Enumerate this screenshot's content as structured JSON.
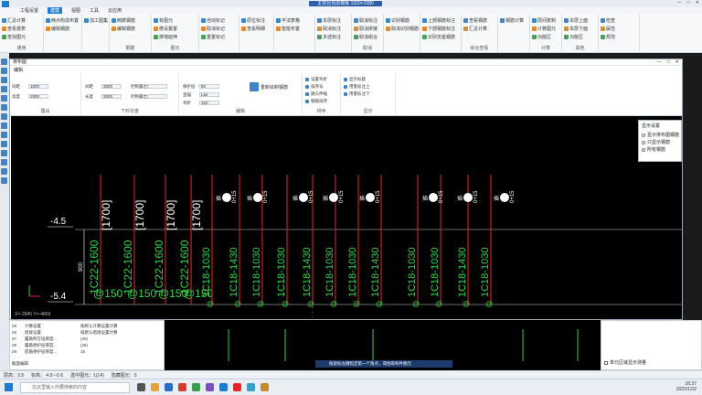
{
  "titlebar": {
    "center_title": "主控台顶层模板   1920×1080",
    "window_controls": [
      "—",
      "□",
      "✕"
    ]
  },
  "menu": {
    "items": [
      "工程设置",
      "建模",
      "视图",
      "工具",
      "云应用"
    ],
    "active": "建模"
  },
  "ribbon": {
    "groups": [
      {
        "label": "通用",
        "buttons": [
          "汇总计算",
          "查看报表",
          "查找图元"
        ]
      },
      {
        "label": "",
        "buttons": [
          "两点构造布置",
          "编辑钢筋"
        ]
      },
      {
        "label": "",
        "buttons": [
          "加工图集"
        ]
      },
      {
        "label": "钢筋",
        "buttons": [
          "两数钢筋",
          "编辑钢筋"
        ]
      },
      {
        "label": "图元",
        "buttons": [
          "有图元",
          "按设置置",
          "按墙延伸"
        ]
      },
      {
        "label": "",
        "buttons": [
          "自动标记",
          "取消标记",
          "重置标记"
        ]
      },
      {
        "label": "",
        "buttons": [
          "原位标注",
          "查看明细"
        ]
      },
      {
        "label": "",
        "buttons": [
          "平法表格",
          "智能布置"
        ]
      },
      {
        "label": "",
        "buttons": [
          "本层标注",
          "取消标注",
          "多选标注"
        ]
      },
      {
        "label": "取消",
        "buttons": [
          "取消标注",
          "取消拼接",
          "取消组合"
        ]
      },
      {
        "label": "",
        "buttons": [
          "识别钢筋",
          "取消识别钢筋"
        ]
      },
      {
        "label": "",
        "buttons": [
          "上部钢筋标注",
          "下部钢筋标注",
          "识别支座钢筋"
        ]
      },
      {
        "label": "综合查看",
        "buttons": [
          "查看钢筋",
          "汇总计算"
        ]
      },
      {
        "label": "",
        "buttons": [
          "钢筋计算"
        ]
      },
      {
        "label": "计算",
        "buttons": [
          "层间复制",
          "计算图元",
          "功能区"
        ]
      },
      {
        "label": "其他",
        "buttons": [
          "本层上面",
          "本层下面",
          "功能区"
        ]
      },
      {
        "label": "",
        "buttons": [
          "检查",
          "属性",
          "规范"
        ]
      }
    ]
  },
  "dialog": {
    "title": "排布图",
    "tab": "编辑",
    "toolbar": {
      "groups": [
        {
          "label": "露出",
          "fields": [
            {
              "name": "间距",
              "value": "1000"
            },
            {
              "name": "高度",
              "value": "2000"
            }
          ]
        },
        {
          "label": "下料长度",
          "fields": [
            {
              "name": "间距",
              "value": "3000"
            },
            {
              "name": "长度",
              "value": "3000"
            },
            {
              "name": "控制露出",
              "value": ""
            },
            {
              "name": "控制露出",
              "value": ""
            }
          ]
        },
        {
          "label": "编辑",
          "fields": [
            {
              "name": "保护层",
              "value": "50"
            },
            {
              "name": "直锚",
              "value": "Lae"
            },
            {
              "name": "弯折",
              "value": "150"
            }
          ]
        },
        {
          "label": "排序",
          "items": [
            "设置弯折",
            "排序号",
            "跳头伸缩",
            "钢筋排序"
          ]
        },
        {
          "label": "显示",
          "items": [
            "显示标题",
            "用量标注上",
            "用量标注下"
          ]
        }
      ],
      "redraw_button": "重新绘制钢筋",
      "scale_label": "1:1"
    },
    "canvas": {
      "elev_top": "-4.5",
      "elev_bottom": "-5.4",
      "dim_vertical": "900",
      "coord_readout": "X=-2845 Y=-4869",
      "left_labels": [
        {
          "text": "1C22-1600",
          "bracket": "[1700]",
          "spacing": "@150"
        },
        {
          "text": "1C22-1600",
          "bracket": "[1700]",
          "spacing": "@150"
        },
        {
          "text": "1C22-1600",
          "bracket": "[1700]",
          "spacing": "@150"
        },
        {
          "text": "1C22-1600",
          "bracket": "[1700]",
          "spacing": "@150"
        }
      ],
      "right_labels": [
        {
          "text": "1C18-1030",
          "spacing": "@"
        },
        {
          "text": "1C18-1430",
          "spacing": "@"
        },
        {
          "text": "1C18-1030",
          "spacing": "@"
        },
        {
          "text": "1C18-1030",
          "spacing": "@"
        },
        {
          "text": "1C18-1430",
          "spacing": "@"
        },
        {
          "text": "1C18-1030",
          "spacing": "@"
        },
        {
          "text": "1C18-1030",
          "spacing": "@"
        },
        {
          "text": "1C18-1430",
          "spacing": "@"
        },
        {
          "text": "1C18-1030",
          "spacing": "@"
        },
        {
          "text": "1C18-1030",
          "spacing": "@"
        },
        {
          "text": "1C18-1430",
          "spacing": "@"
        },
        {
          "text": "1C18-1030",
          "spacing": "@"
        }
      ],
      "marker_text": "0+15",
      "marker_label": "插"
    },
    "options_popup": {
      "title": "显示设置",
      "options": [
        "显示排布图钢筋",
        "只显示钢筋",
        "所有钢筋"
      ]
    }
  },
  "props_panel": {
    "rows": [
      {
        "num": "25",
        "name": "计算设置",
        "value": "按默认计算设置计算"
      },
      {
        "num": "26",
        "name": "搭接设置",
        "value": "按默认搭接设置计算"
      },
      {
        "num": "27",
        "name": "露筋所在墙厚度...",
        "value": "(25)"
      },
      {
        "num": "28",
        "name": "露筋保护层厚度...",
        "value": "(25)"
      },
      {
        "num": "29",
        "name": "底筋保护层厚度...",
        "value": "15"
      }
    ],
    "footer": "截面编辑"
  },
  "right_panel": {
    "checkbox": "单元区域显示测量"
  },
  "statusbar": {
    "items": [
      "层高：3.9",
      "标高：-4.5~-0.6",
      "选中图元：1(14)",
      "隐藏图元：0"
    ],
    "hint": "按鼠标左键指定第一个角点，或拾取构件图元"
  },
  "taskbar": {
    "search_placeholder": "在这里输入你要搜索的内容",
    "time": "16:37",
    "date": "2022/12/2"
  },
  "colors": {
    "accent": "#1f7bd1",
    "rebar_red": "#e8242a",
    "rebar_green": "#2fd24a",
    "canvas_bg": "#000000"
  }
}
